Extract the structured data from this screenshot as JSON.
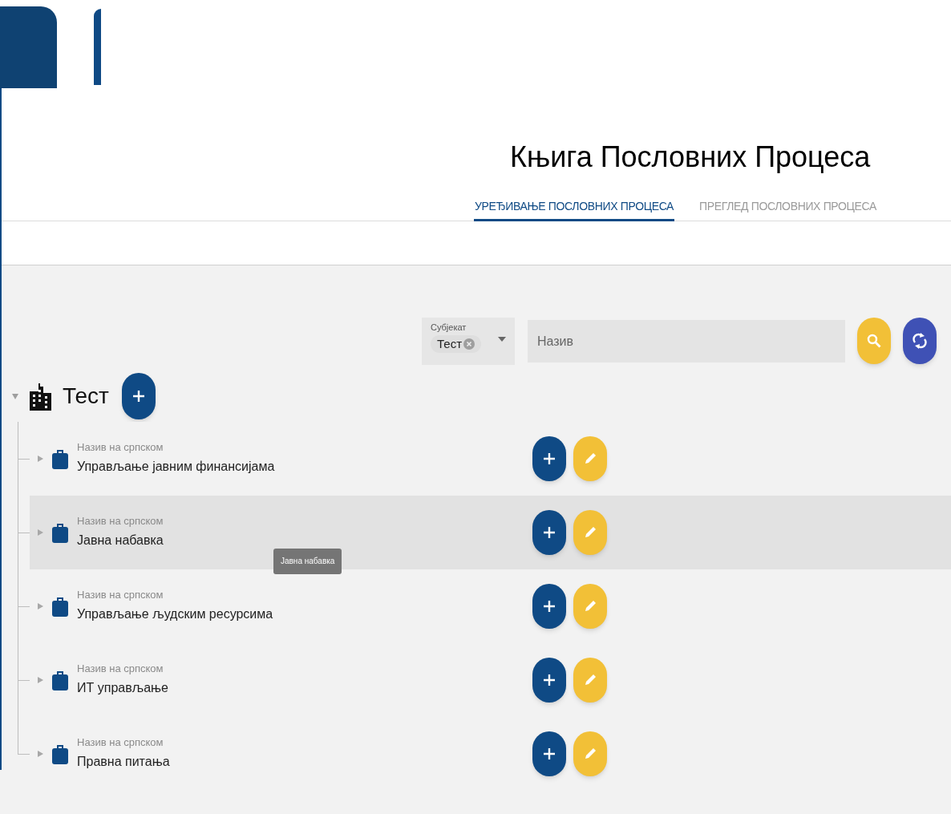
{
  "title": "Књига Пословних Процеса",
  "tabs": [
    {
      "label": "УРЕЂИВАЊЕ ПОСЛОВНИХ ПРОЦЕСА",
      "selected": true
    },
    {
      "label": "ПРЕГЛЕД ПОСЛОВНИХ ПРОЦЕСА",
      "selected": false
    }
  ],
  "filter": {
    "subject_label": "Субјекат",
    "subject_chip": "Тест",
    "name_placeholder": "Назив"
  },
  "tree": {
    "label": "Тест",
    "expanded": true,
    "children": [
      {
        "caption": "Назив на српском",
        "name": "Управљање јавним финансијама",
        "expanded": false,
        "hovered": false
      },
      {
        "caption": "Назив на српском",
        "name": "Јавна набавка",
        "expanded": false,
        "hovered": true,
        "tooltip": "Јавна набавка"
      },
      {
        "caption": "Назив на српском",
        "name": "Управљање људским ресурсима",
        "expanded": false,
        "hovered": false
      },
      {
        "caption": "Назив на српском",
        "name": "ИТ управљање",
        "expanded": false,
        "hovered": false
      },
      {
        "caption": "Назив на српском",
        "name": "Правна питања",
        "expanded": false,
        "hovered": false
      }
    ]
  }
}
